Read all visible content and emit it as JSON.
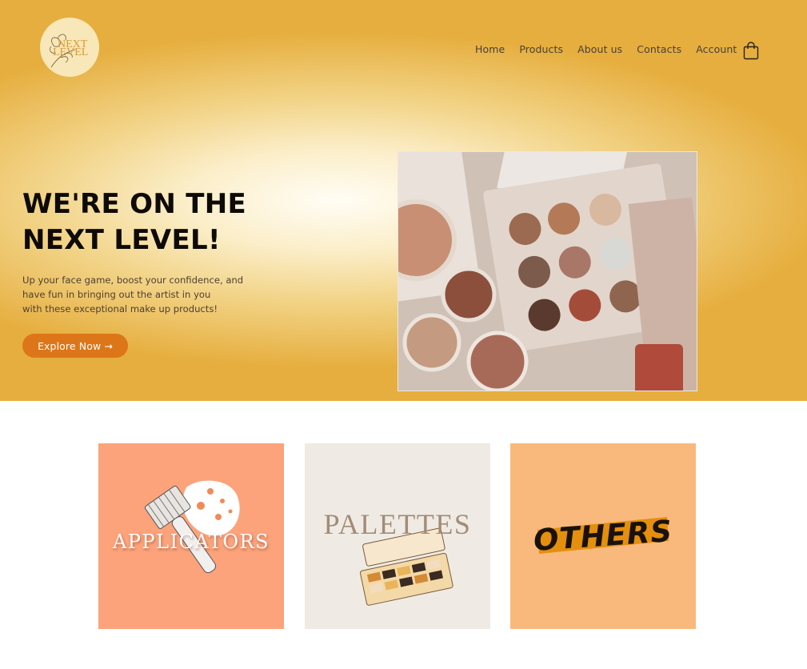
{
  "brand": {
    "logo_text_1": "NEXT",
    "logo_text_2": "LEVEL",
    "logo_accent": "#d89a3a"
  },
  "nav": {
    "items": [
      {
        "label": "Home"
      },
      {
        "label": "Products"
      },
      {
        "label": "About us"
      },
      {
        "label": "Contacts"
      },
      {
        "label": "Account"
      }
    ],
    "cart_icon": "shopping-bag-icon"
  },
  "hero": {
    "headline_line1": "WE'RE ON THE",
    "headline_line2": "NEXT LEVEL!",
    "sub_line1": "Up your face game, boost your confidence, and",
    "sub_line2": "have fun in bringing out the artist in you",
    "sub_line3": "with these exceptional make up products!",
    "cta_label": "Explore Now →",
    "cta_color": "#dd7618"
  },
  "categories": [
    {
      "label": "APPLICATORS",
      "color": "#fca37b"
    },
    {
      "label": "PALETTES",
      "color": "#efebe4"
    },
    {
      "label": "OTHERS",
      "color": "#f9b97c"
    }
  ],
  "colors": {
    "hero_gold": "#e6ae3e",
    "hero_light": "#fffdf5"
  }
}
